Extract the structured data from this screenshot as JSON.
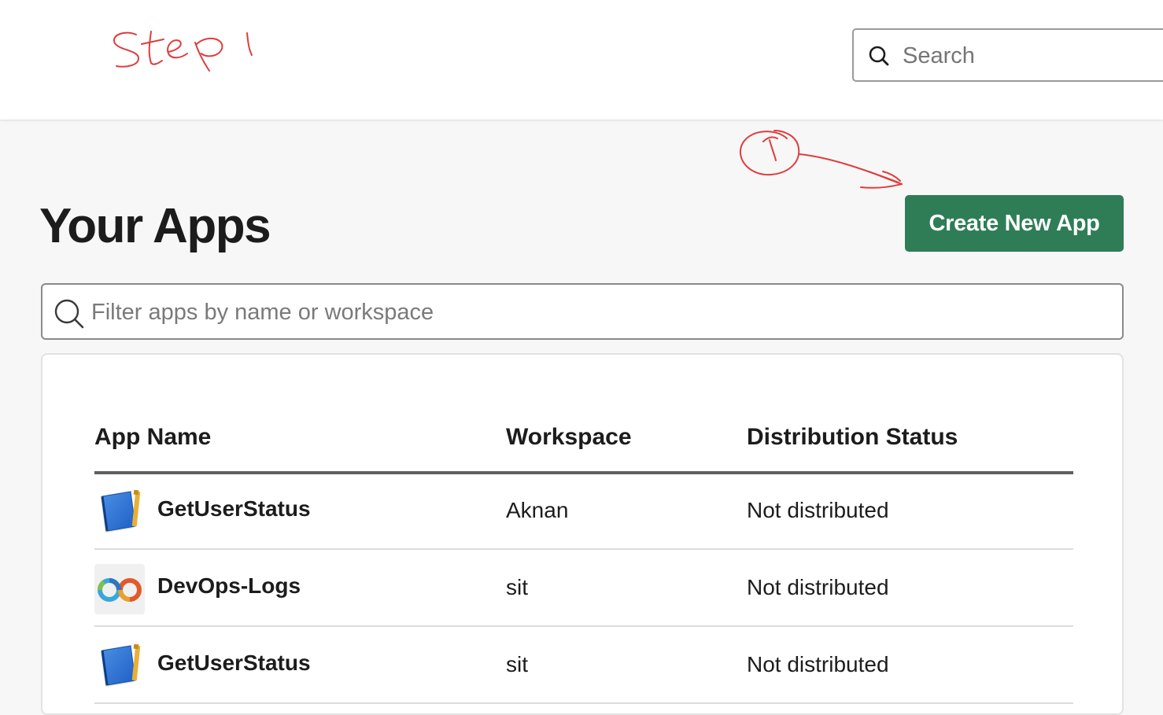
{
  "header": {
    "search_placeholder": "Search"
  },
  "annotations": {
    "step_label": "Step 1",
    "circle_number": "1",
    "color": "#e03c3c"
  },
  "main": {
    "title": "Your Apps",
    "create_button_label": "Create New App",
    "filter_placeholder": "Filter apps by name or workspace",
    "table": {
      "columns": [
        "App Name",
        "Workspace",
        "Distribution Status"
      ],
      "rows": [
        {
          "name": "GetUserStatus",
          "workspace": "Aknan",
          "status": "Not distributed",
          "icon": "notebook-icon"
        },
        {
          "name": "DevOps-Logs",
          "workspace": "sit",
          "status": "Not distributed",
          "icon": "devops-infinity-icon"
        },
        {
          "name": "GetUserStatus",
          "workspace": "sit",
          "status": "Not distributed",
          "icon": "notebook-icon"
        }
      ]
    }
  },
  "colors": {
    "accent_button": "#2e7d57",
    "background": "#f7f7f7",
    "text": "#1d1c1d"
  }
}
